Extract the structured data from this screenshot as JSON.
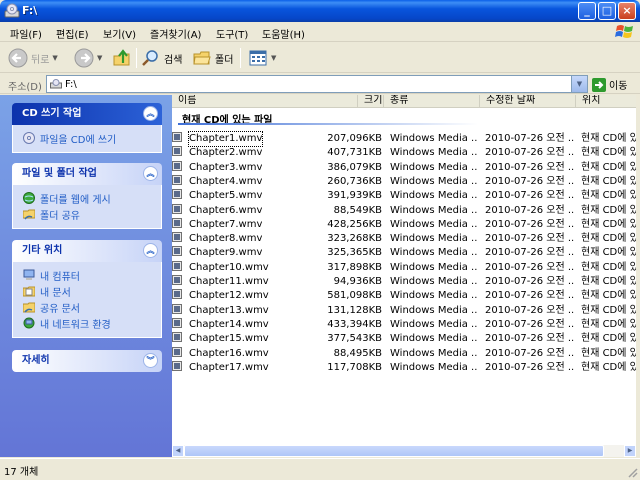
{
  "window": {
    "title": "F:\\"
  },
  "menu": [
    "파일(F)",
    "편집(E)",
    "보기(V)",
    "즐겨찾기(A)",
    "도구(T)",
    "도움말(H)"
  ],
  "toolbar": {
    "back": "뒤로",
    "search": "검색",
    "folders": "폴더"
  },
  "address": {
    "label": "주소(D)",
    "value": "F:\\",
    "go": "이동"
  },
  "taskpane": {
    "cd": {
      "title": "CD 쓰기 작업",
      "items": [
        "파일을 CD에 쓰기"
      ]
    },
    "file": {
      "title": "파일 및 폴더 작업",
      "items": [
        "폴더를 웹에 게시",
        "폴더 공유"
      ]
    },
    "other": {
      "title": "기타 위치",
      "items": [
        "내 컴퓨터",
        "내 문서",
        "공유 문서",
        "내 네트워크 환경"
      ]
    },
    "details": {
      "title": "자세히"
    }
  },
  "columns": {
    "name": "이름",
    "size": "크기",
    "type": "종류",
    "modified": "수정한 날짜",
    "location": "위치"
  },
  "group": "현재 CD에 있는 파일",
  "files": [
    {
      "name": "Chapter1.wmv",
      "size": "207,096KB",
      "type": "Windows Media ...",
      "date": "2010-07-26 오전 ...",
      "loc": "현재 CD에 있"
    },
    {
      "name": "Chapter2.wmv",
      "size": "407,731KB",
      "type": "Windows Media ...",
      "date": "2010-07-26 오전 ...",
      "loc": "현재 CD에 있"
    },
    {
      "name": "Chapter3.wmv",
      "size": "386,079KB",
      "type": "Windows Media ...",
      "date": "2010-07-26 오전 ...",
      "loc": "현재 CD에 있"
    },
    {
      "name": "Chapter4.wmv",
      "size": "260,736KB",
      "type": "Windows Media ...",
      "date": "2010-07-26 오전 ...",
      "loc": "현재 CD에 있"
    },
    {
      "name": "Chapter5.wmv",
      "size": "391,939KB",
      "type": "Windows Media ...",
      "date": "2010-07-26 오전 ...",
      "loc": "현재 CD에 있"
    },
    {
      "name": "Chapter6.wmv",
      "size": "88,549KB",
      "type": "Windows Media ...",
      "date": "2010-07-26 오전 ...",
      "loc": "현재 CD에 있"
    },
    {
      "name": "Chapter7.wmv",
      "size": "428,256KB",
      "type": "Windows Media ...",
      "date": "2010-07-26 오전 ...",
      "loc": "현재 CD에 있"
    },
    {
      "name": "Chapter8.wmv",
      "size": "323,268KB",
      "type": "Windows Media ...",
      "date": "2010-07-26 오전 ...",
      "loc": "현재 CD에 있"
    },
    {
      "name": "Chapter9.wmv",
      "size": "325,365KB",
      "type": "Windows Media ...",
      "date": "2010-07-26 오전 ...",
      "loc": "현재 CD에 있"
    },
    {
      "name": "Chapter10.wmv",
      "size": "317,898KB",
      "type": "Windows Media ...",
      "date": "2010-07-26 오전 ...",
      "loc": "현재 CD에 있"
    },
    {
      "name": "Chapter11.wmv",
      "size": "94,936KB",
      "type": "Windows Media ...",
      "date": "2010-07-26 오전 ...",
      "loc": "현재 CD에 있"
    },
    {
      "name": "Chapter12.wmv",
      "size": "581,098KB",
      "type": "Windows Media ...",
      "date": "2010-07-26 오전 ...",
      "loc": "현재 CD에 있"
    },
    {
      "name": "Chapter13.wmv",
      "size": "131,128KB",
      "type": "Windows Media ...",
      "date": "2010-07-26 오전 ...",
      "loc": "현재 CD에 있"
    },
    {
      "name": "Chapter14.wmv",
      "size": "433,394KB",
      "type": "Windows Media ...",
      "date": "2010-07-26 오전 ...",
      "loc": "현재 CD에 있"
    },
    {
      "name": "Chapter15.wmv",
      "size": "377,543KB",
      "type": "Windows Media ...",
      "date": "2010-07-26 오전 ...",
      "loc": "현재 CD에 있"
    },
    {
      "name": "Chapter16.wmv",
      "size": "88,495KB",
      "type": "Windows Media ...",
      "date": "2010-07-26 오전 ...",
      "loc": "현재 CD에 있"
    },
    {
      "name": "Chapter17.wmv",
      "size": "117,708KB",
      "type": "Windows Media ...",
      "date": "2010-07-26 오전 ...",
      "loc": "현재 CD에 있"
    }
  ],
  "status": "17 개체",
  "colors": {
    "title_blue": "#0855DD",
    "pane_blue": "#6375D6",
    "link_blue": "#215DC6"
  }
}
